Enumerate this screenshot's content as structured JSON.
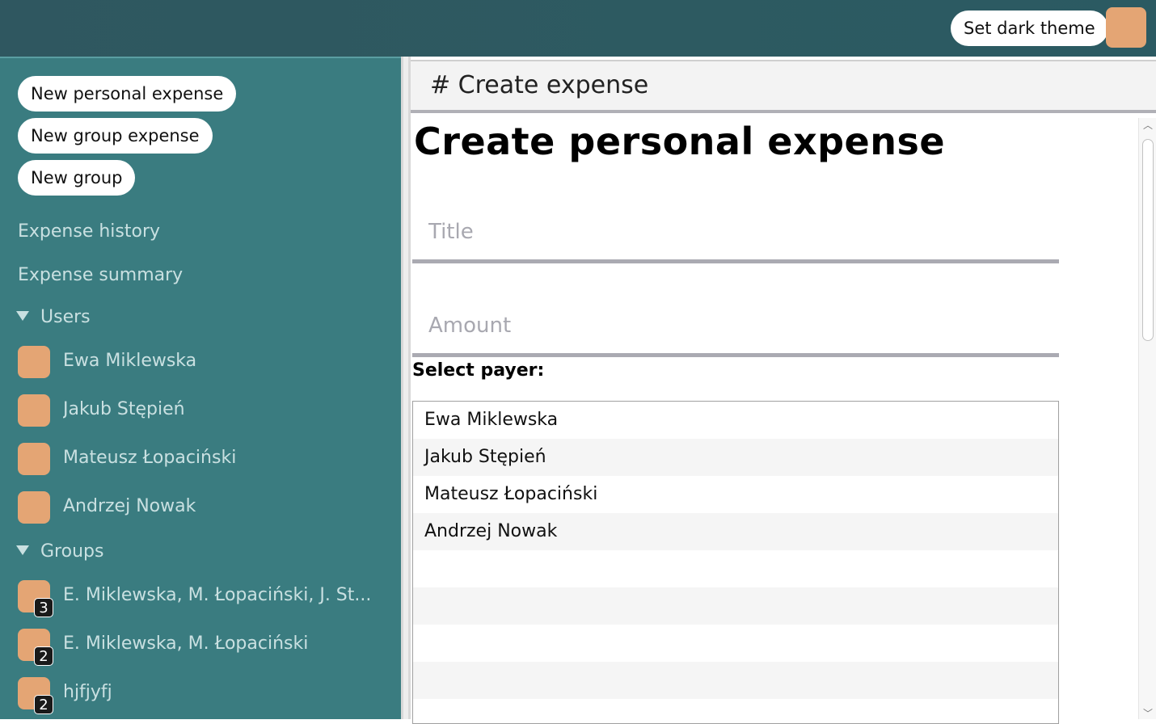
{
  "header": {
    "theme_button": "Set dark theme"
  },
  "sidebar": {
    "actions": [
      "New personal expense",
      "New group expense",
      "New group"
    ],
    "links": [
      "Expense history",
      "Expense summary"
    ],
    "users_heading": "Users",
    "users": [
      "Ewa Miklewska",
      "Jakub Stępień",
      "Mateusz Łopaciński",
      "Andrzej Nowak"
    ],
    "groups_heading": "Groups",
    "groups": [
      {
        "name": "E. Miklewska, M. Łopaciński, J. St...",
        "count": "3"
      },
      {
        "name": "E. Miklewska, M. Łopaciński",
        "count": "2"
      },
      {
        "name": "hjfjyfj",
        "count": "2"
      }
    ]
  },
  "main": {
    "channel_title": "# Create expense",
    "page_title": "Create personal expense",
    "title_placeholder": "Title",
    "amount_placeholder": "Amount",
    "select_label": "Select payer:",
    "payers": [
      "Ewa Miklewska",
      "Jakub Stępień",
      "Mateusz Łopaciński",
      "Andrzej Nowak",
      "",
      "",
      "",
      "",
      ""
    ]
  },
  "colors": {
    "topbar": "#2d5a61",
    "sidebar": "#3a7c80",
    "avatar": "#e4a574"
  }
}
